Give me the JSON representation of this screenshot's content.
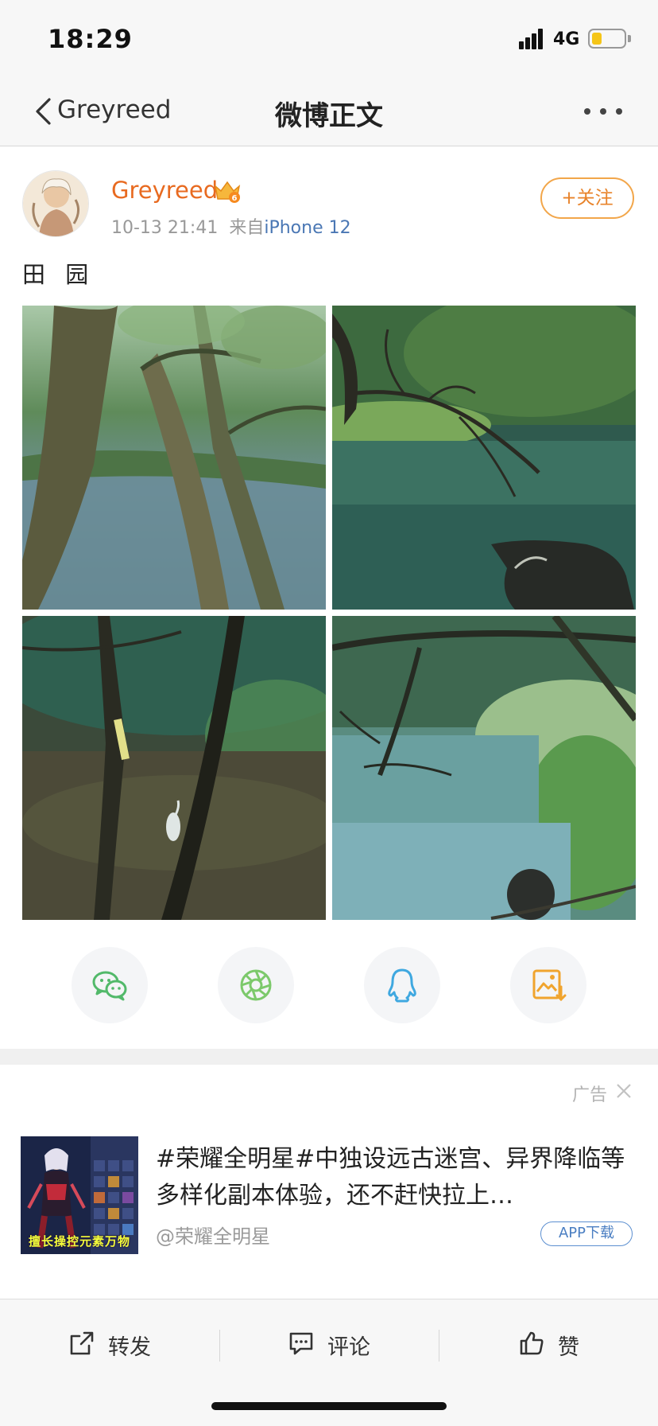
{
  "status_bar": {
    "time": "18:29",
    "network": "4G",
    "battery_color": "#f5c518"
  },
  "nav": {
    "back_label": "Greyreed",
    "title": "微博正文",
    "back_icon": "chevron-left-icon",
    "more_icon": "more-dots-icon"
  },
  "post": {
    "author": "Greyreed",
    "author_color": "#e86a20",
    "date": "10-13 21:41",
    "source_prefix": "来自",
    "device": "iPhone 12",
    "follow_label": "+关注",
    "text": "田 园",
    "photos": [
      {
        "name": "photo-trees-river"
      },
      {
        "name": "photo-branches-pond-buffalo"
      },
      {
        "name": "photo-forest-egret"
      },
      {
        "name": "photo-river-buffalo"
      }
    ]
  },
  "share": {
    "items": [
      {
        "icon": "wechat-icon",
        "color": "#52b96a"
      },
      {
        "icon": "moments-icon",
        "color": "#7cc96b"
      },
      {
        "icon": "qq-icon",
        "color": "#3fa8e0"
      },
      {
        "icon": "save-image-icon",
        "color": "#f0a42e"
      }
    ]
  },
  "ad": {
    "label": "广告",
    "close_icon": "close-icon",
    "title": "#荣耀全明星#中独设远古迷宫、异界降临等多样化副本体验，还不赶快拉上…",
    "source": "@荣耀全明星",
    "download_label": "APP下载",
    "thumb_caption": "擅长操控元素万物"
  },
  "toolbar": {
    "repost_label": "转发",
    "comment_label": "评论",
    "like_label": "赞"
  }
}
